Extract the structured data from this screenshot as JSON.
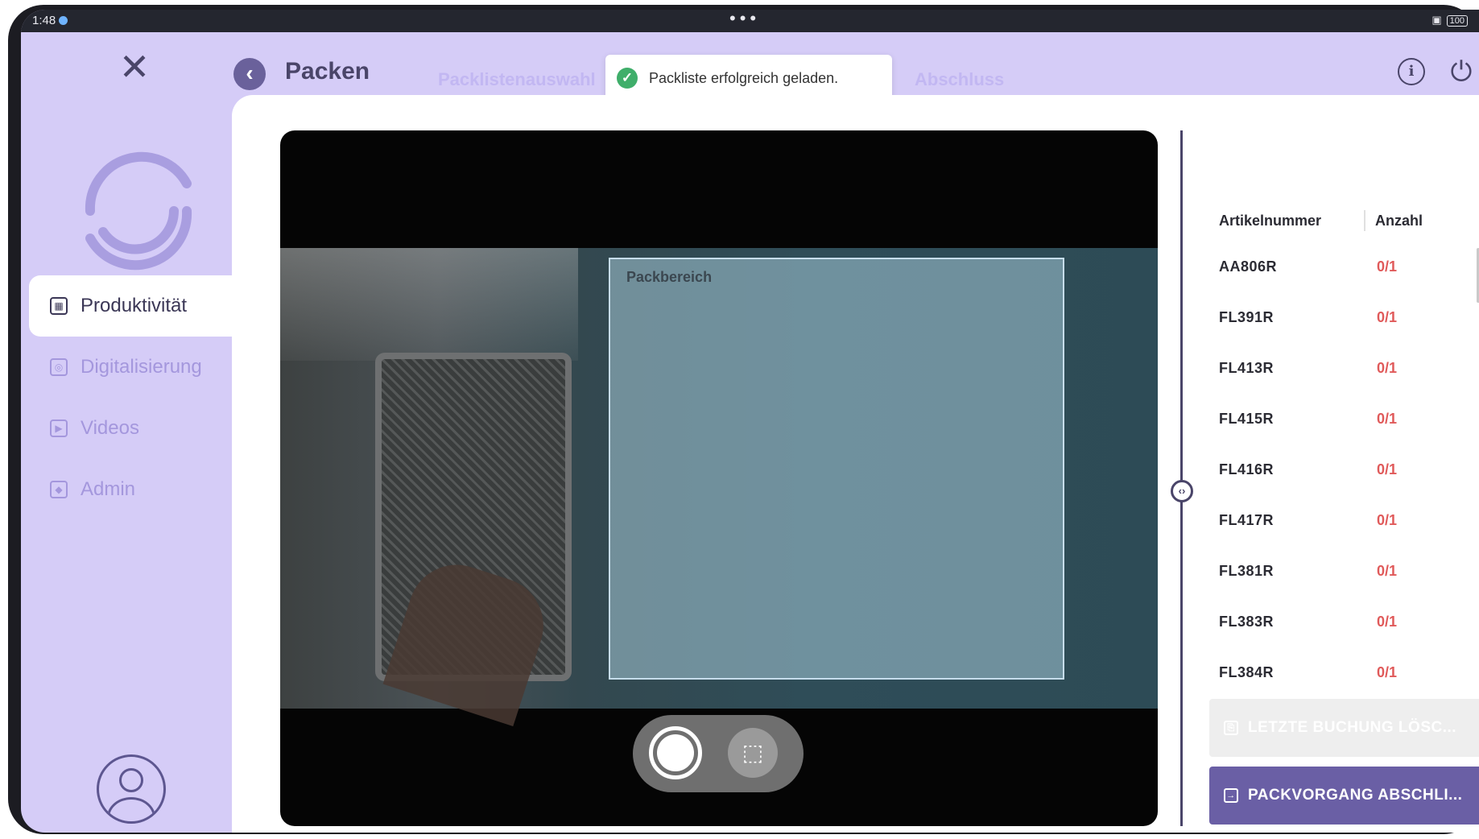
{
  "status_bar": {
    "time": "1:48",
    "battery": "100"
  },
  "header": {
    "title": "Packen",
    "steps": [
      "Packlistenauswahl",
      "Abschluss"
    ],
    "toast": "Packliste erfolgreich geladen."
  },
  "sidebar": {
    "items": [
      {
        "label": "Produktivität",
        "active": true
      },
      {
        "label": "Digitalisierung"
      },
      {
        "label": "Videos"
      },
      {
        "label": "Admin"
      }
    ]
  },
  "camera": {
    "area_label": "Packbereich"
  },
  "table": {
    "headers": [
      "Artikelnummer",
      "Anzahl"
    ],
    "rows": [
      {
        "article": "AA806R",
        "count": "0/1"
      },
      {
        "article": "FL391R",
        "count": "0/1"
      },
      {
        "article": "FL413R",
        "count": "0/1"
      },
      {
        "article": "FL415R",
        "count": "0/1"
      },
      {
        "article": "FL416R",
        "count": "0/1"
      },
      {
        "article": "FL417R",
        "count": "0/1"
      },
      {
        "article": "FL381R",
        "count": "0/1"
      },
      {
        "article": "FL383R",
        "count": "0/1"
      },
      {
        "article": "FL384R",
        "count": "0/1"
      }
    ]
  },
  "actions": {
    "undo_label": "LETZTE BUCHUNG LÖSC...",
    "finish_label": "PACKVORGANG ABSCHLI..."
  },
  "colors": {
    "sidebar_bg": "#d5ccf7",
    "accent": "#6a5fa5",
    "count_red": "#e05a5a",
    "toast_success": "#3fae6a"
  },
  "icons": [
    "close-icon",
    "back-arrow-icon",
    "check-circle-icon",
    "info-icon",
    "power-icon",
    "calendar-icon",
    "scan-icon",
    "video-icon",
    "shield-icon",
    "user-icon",
    "capture-icon",
    "roi-icon",
    "undo-icon",
    "exit-icon"
  ]
}
